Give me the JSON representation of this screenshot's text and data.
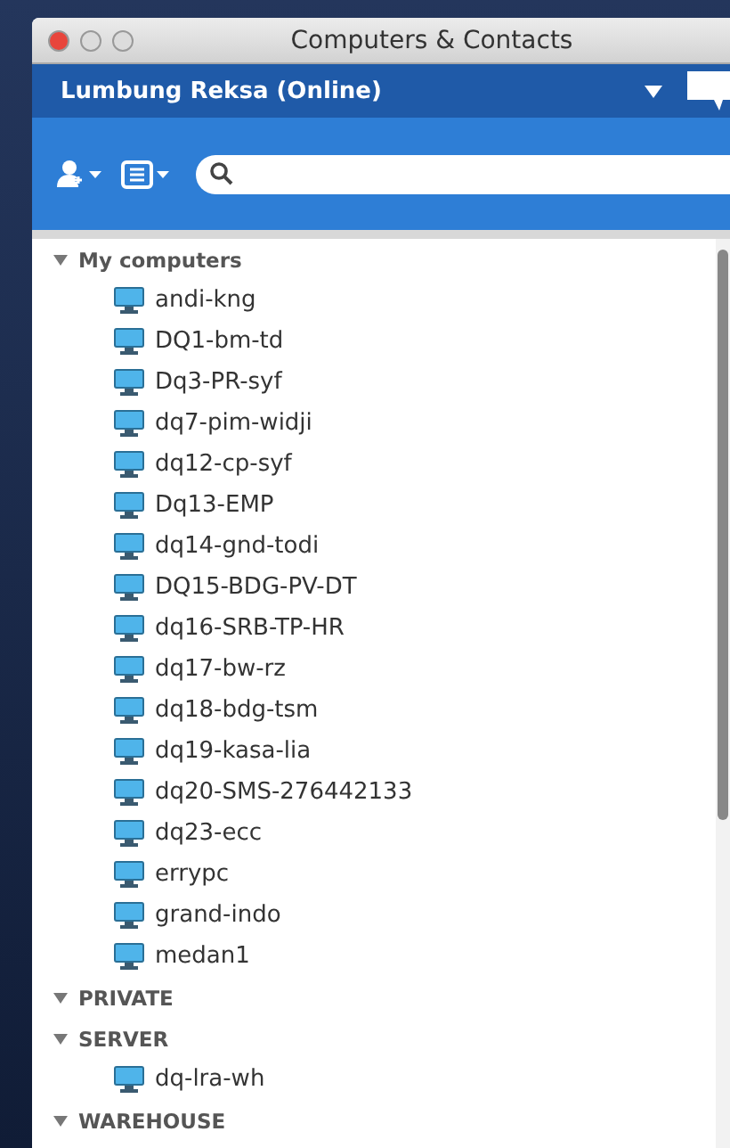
{
  "window": {
    "title": "Computers & Contacts"
  },
  "account": {
    "name": "Lumbung Reksa (Online)"
  },
  "groups": [
    {
      "name": "My computers",
      "expanded": true,
      "children": [
        {
          "name": "andi-kng"
        },
        {
          "name": "DQ1-bm-td"
        },
        {
          "name": "Dq3-PR-syf"
        },
        {
          "name": "dq7-pim-widji"
        },
        {
          "name": "dq12-cp-syf"
        },
        {
          "name": "Dq13-EMP"
        },
        {
          "name": "dq14-gnd-todi"
        },
        {
          "name": "DQ15-BDG-PV-DT"
        },
        {
          "name": "dq16-SRB-TP-HR"
        },
        {
          "name": "dq17-bw-rz"
        },
        {
          "name": "dq18-bdg-tsm"
        },
        {
          "name": "dq19-kasa-lia"
        },
        {
          "name": "dq20-SMS-276442133"
        },
        {
          "name": "dq23-ecc"
        },
        {
          "name": "errypc"
        },
        {
          "name": "grand-indo"
        },
        {
          "name": "medan1"
        }
      ]
    },
    {
      "name": "PRIVATE",
      "expanded": true
    },
    {
      "name": "SERVER",
      "expanded": true,
      "children": [
        {
          "name": "dq-lra-wh"
        }
      ]
    },
    {
      "name": "WAREHOUSE",
      "expanded": true
    }
  ]
}
